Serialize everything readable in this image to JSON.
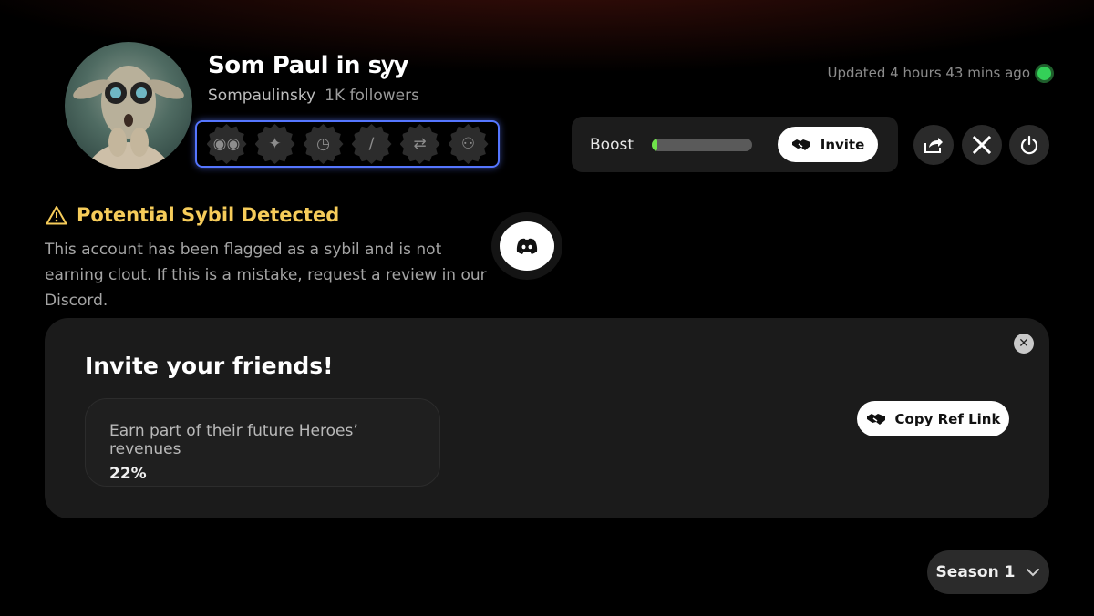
{
  "profile": {
    "display_name": "Som Paul in sỿу",
    "handle": "Sompaulinsky",
    "followers": "1K followers",
    "avatar_icon": "alien-avatar"
  },
  "badges": [
    {
      "icon": "eyes-icon",
      "glyph": "◉◉"
    },
    {
      "icon": "wand-icon",
      "glyph": "✦"
    },
    {
      "icon": "clock-icon",
      "glyph": "◷"
    },
    {
      "icon": "feather-icon",
      "glyph": "∕"
    },
    {
      "icon": "repeat-icon",
      "glyph": "⇄"
    },
    {
      "icon": "users-icon",
      "glyph": "⚇"
    }
  ],
  "status": {
    "updated_text": "Updated 4 hours 43 mins ago",
    "indicator_color": "#34d058"
  },
  "boost": {
    "label": "Boost",
    "progress": 0.05,
    "invite_label": "Invite"
  },
  "actions": {
    "share_icon": "share-icon",
    "x_icon": "x-logo-icon",
    "power_icon": "power-icon"
  },
  "warning": {
    "title": "Potential Sybil Detected",
    "text": "This account has been flagged as a sybil and is not earning clout. If this is a mistake, request a review in our Discord.",
    "color": "#f6cc5a",
    "discord_icon": "discord-icon"
  },
  "invite_card": {
    "title": "Invite your friends!",
    "earn_label": "Earn part of their future Heroes’ revenues",
    "earn_value": "22%",
    "copy_label": "Copy Ref Link",
    "close_glyph": "✕"
  },
  "season": {
    "label": "Season 1"
  }
}
